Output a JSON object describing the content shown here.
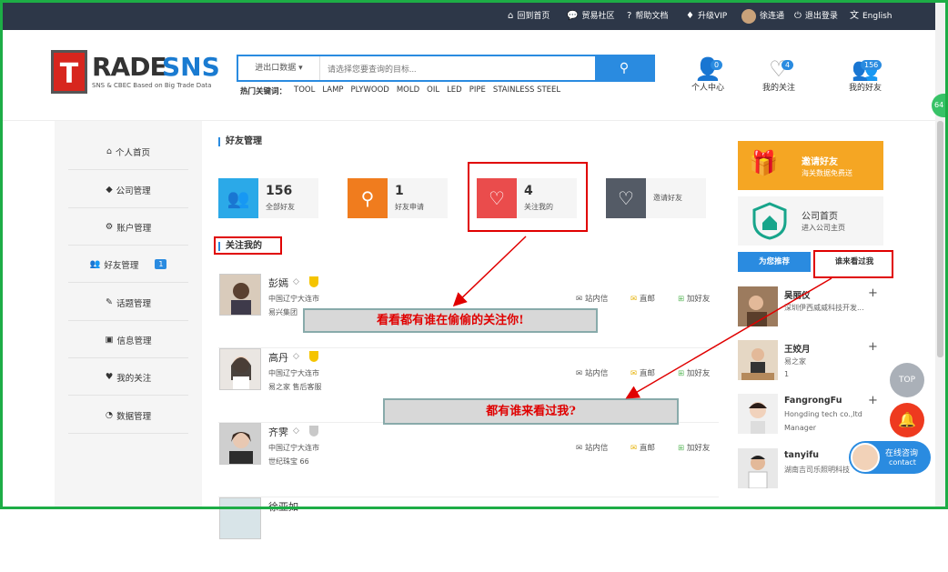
{
  "topbar": {
    "links": [
      {
        "icon": "home-icon",
        "label": "回到首页"
      },
      {
        "icon": "chat-icon",
        "label": "贸易社区"
      },
      {
        "icon": "help-icon",
        "label": "帮助文档"
      },
      {
        "icon": "diamond-icon",
        "label": "升级VIP"
      },
      {
        "icon": "user-avatar",
        "label": "徐连通"
      },
      {
        "icon": "power-icon",
        "label": "退出登录"
      },
      {
        "icon": "translate-icon",
        "label": "English"
      }
    ]
  },
  "header": {
    "logo": {
      "t": "T",
      "rade": "RADE",
      "sns": "SNS",
      "tagline": "SNS & CBEC Based on Big Trade Data"
    },
    "search": {
      "select_label": "进出口数据",
      "placeholder": "请选择您要查询的目标..."
    },
    "hot_label": "热门关键词：",
    "hot_keywords": [
      "TOOL",
      "LAMP",
      "PLYWOOD",
      "MOLD",
      "OIL",
      "LED",
      "PIPE",
      "STAINLESS STEEL"
    ],
    "icons": [
      {
        "label": "个人中心",
        "badge": "0"
      },
      {
        "label": "我的关注",
        "badge": "4"
      },
      {
        "label": "我的好友",
        "badge": "156"
      }
    ]
  },
  "sidebar": {
    "items": [
      {
        "icon": "home-icon",
        "label": "个人首页"
      },
      {
        "icon": "cube-icon",
        "label": "公司管理"
      },
      {
        "icon": "gears-icon",
        "label": "账户管理"
      },
      {
        "icon": "users-icon",
        "label": "好友管理",
        "badge": "1"
      },
      {
        "icon": "edit-icon",
        "label": "话题管理"
      },
      {
        "icon": "file-icon",
        "label": "信息管理"
      },
      {
        "icon": "heart-icon",
        "label": "我的关注"
      },
      {
        "icon": "pie-chart-icon",
        "label": "数据管理"
      }
    ]
  },
  "main": {
    "title": "好友管理",
    "stats": [
      {
        "num": "156",
        "label": "全部好友",
        "color": "#2ba9e8"
      },
      {
        "num": "1",
        "label": "好友申请",
        "color": "#f07c1e"
      },
      {
        "num": "4",
        "label": "关注我的",
        "color": "#ea4c4c"
      },
      {
        "num": "",
        "label": "邀请好友",
        "color": "#545b66"
      }
    ],
    "section": "关注我的",
    "actions": {
      "msg": "站内信",
      "mail": "直邮",
      "add": "加好友"
    },
    "friends": [
      {
        "name": "彭嫣",
        "loc": "中国辽宁大连市",
        "co": "易兴集团"
      },
      {
        "name": "高丹",
        "loc": "中国辽宁大连市",
        "co": "易之家 售后客服"
      },
      {
        "name": "齐霁",
        "loc": "中国辽宁大连市",
        "co": "世纪珠宝 66"
      },
      {
        "name": "徐亚如"
      }
    ],
    "callout1": "看看都有谁在偷偷的关注你!",
    "callout2": "都有谁来看过我?"
  },
  "right": {
    "invite": {
      "title": "邀请好友",
      "sub": "海关数据免费送"
    },
    "company": {
      "title": "公司首页",
      "sub": "进入公司主页"
    },
    "tabs": [
      "为您推荐",
      "谁来看过我"
    ],
    "visitors": [
      {
        "name": "吴丽仪",
        "co": "深圳伊西威威科技开发...",
        "role": ""
      },
      {
        "name": "王姣月",
        "co": "易之家",
        "role": "1"
      },
      {
        "name": "FangrongFu",
        "co": "Hongding tech co.,ltd",
        "role": "Manager"
      },
      {
        "name": "tanyifu",
        "co": "湖南吉司乐照明科技",
        "role": ""
      }
    ]
  },
  "floating": {
    "top": "TOP",
    "chat_a": "在线咨询",
    "chat_b": "contact",
    "side_badge": "64"
  },
  "colors": {
    "accent": "#2a8be0",
    "topbar": "#2d3748",
    "frame": "#1dad46",
    "highlight": "#e00000"
  }
}
